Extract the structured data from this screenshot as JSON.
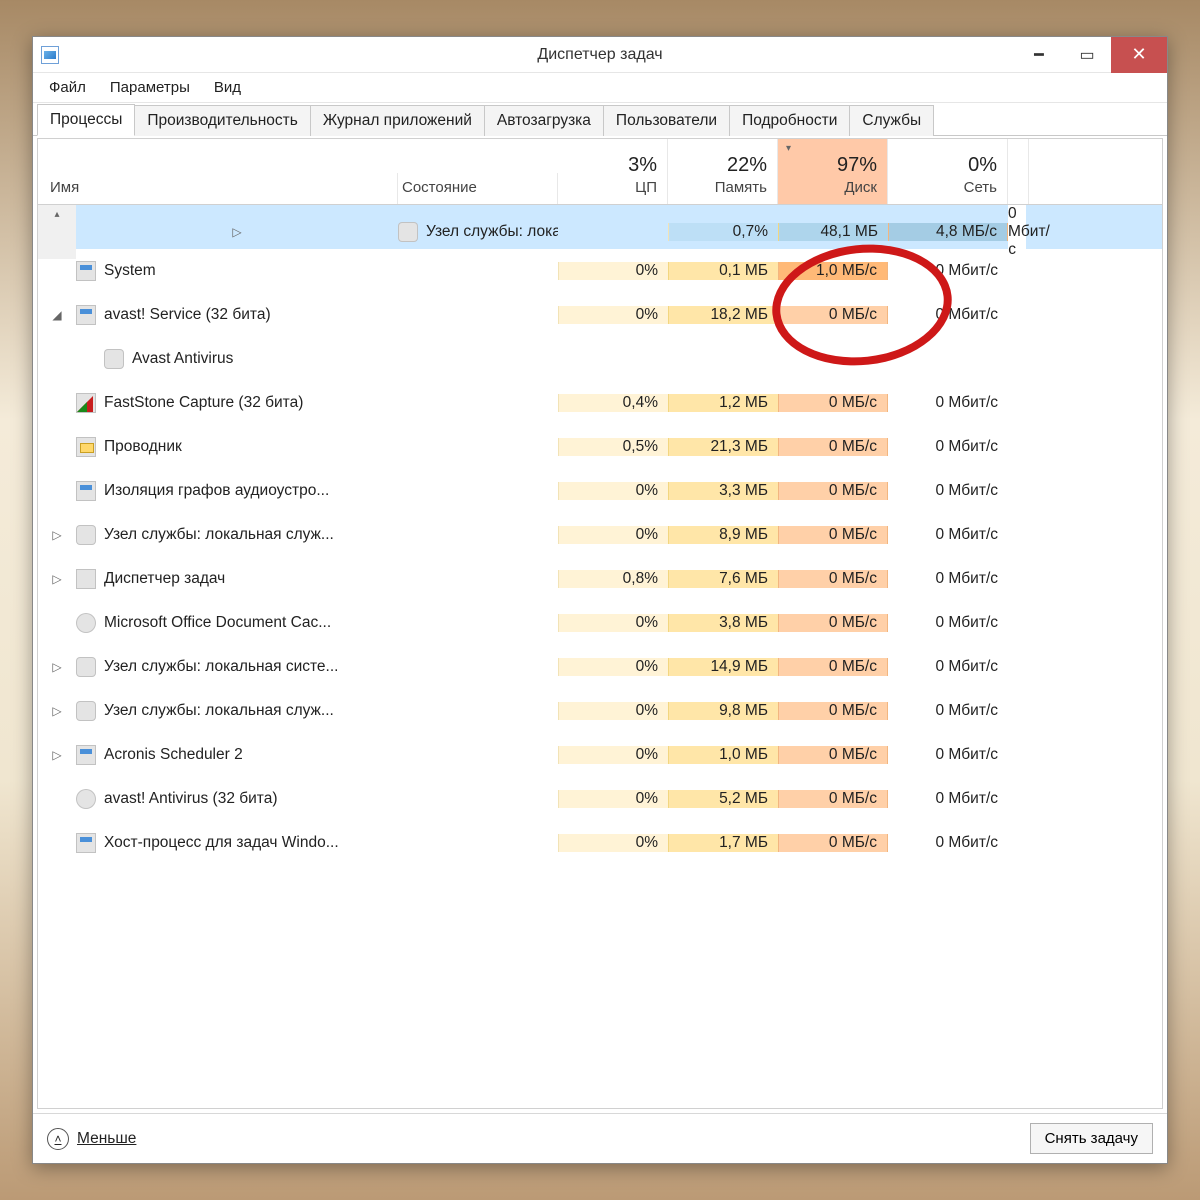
{
  "window": {
    "title": "Диспетчер задач"
  },
  "menu": {
    "file": "Файл",
    "options": "Параметры",
    "view": "Вид"
  },
  "tabs": {
    "processes": "Процессы",
    "performance": "Производительность",
    "app_history": "Журнал приложений",
    "startup": "Автозагрузка",
    "users": "Пользователи",
    "details": "Подробности",
    "services": "Службы"
  },
  "columns": {
    "name": "Имя",
    "status": "Состояние",
    "cpu_pct": "3%",
    "cpu_lbl": "ЦП",
    "mem_pct": "22%",
    "mem_lbl": "Память",
    "disk_pct": "97%",
    "disk_lbl": "Диск",
    "net_pct": "0%",
    "net_lbl": "Сеть"
  },
  "rows": [
    {
      "exp": "▷",
      "icon": "gear",
      "name": "Узел службы: локальная систе...",
      "cpu": "0,7%",
      "mem": "48,1 МБ",
      "disk": "4,8 МБ/с",
      "net": "0 Мбит/с",
      "selected": true
    },
    {
      "exp": "",
      "icon": "app",
      "name": "System",
      "cpu": "0%",
      "mem": "0,1 МБ",
      "disk": "1,0 МБ/с",
      "net": "0 Мбит/с",
      "diskhigh": true
    },
    {
      "exp": "◢",
      "icon": "app",
      "name": "avast! Service (32 бита)",
      "cpu": "0%",
      "mem": "18,2 МБ",
      "disk": "0 МБ/с",
      "net": "0 Мбит/с"
    },
    {
      "exp": "",
      "icon": "gear",
      "name": "Avast Antivirus",
      "child": true,
      "cpu": "",
      "mem": "",
      "disk": "",
      "net": ""
    },
    {
      "exp": "",
      "icon": "fs",
      "name": "FastStone Capture (32 бита)",
      "cpu": "0,4%",
      "mem": "1,2 МБ",
      "disk": "0 МБ/с",
      "net": "0 Мбит/с"
    },
    {
      "exp": "",
      "icon": "explorer",
      "name": "Проводник",
      "cpu": "0,5%",
      "mem": "21,3 МБ",
      "disk": "0 МБ/с",
      "net": "0 Мбит/с"
    },
    {
      "exp": "",
      "icon": "app",
      "name": "Изоляция графов аудиоустро...",
      "cpu": "0%",
      "mem": "3,3 МБ",
      "disk": "0 МБ/с",
      "net": "0 Мбит/с"
    },
    {
      "exp": "▷",
      "icon": "gear",
      "name": "Узел службы: локальная служ...",
      "cpu": "0%",
      "mem": "8,9 МБ",
      "disk": "0 МБ/с",
      "net": "0 Мбит/с"
    },
    {
      "exp": "▷",
      "icon": "tm",
      "name": "Диспетчер задач",
      "cpu": "0,8%",
      "mem": "7,6 МБ",
      "disk": "0 МБ/с",
      "net": "0 Мбит/с"
    },
    {
      "exp": "",
      "icon": "ms",
      "name": "Microsoft Office Document Cac...",
      "cpu": "0%",
      "mem": "3,8 МБ",
      "disk": "0 МБ/с",
      "net": "0 Мбит/с"
    },
    {
      "exp": "▷",
      "icon": "gear",
      "name": "Узел службы: локальная систе...",
      "cpu": "0%",
      "mem": "14,9 МБ",
      "disk": "0 МБ/с",
      "net": "0 Мбит/с"
    },
    {
      "exp": "▷",
      "icon": "gear",
      "name": "Узел службы: локальная служ...",
      "cpu": "0%",
      "mem": "9,8 МБ",
      "disk": "0 МБ/с",
      "net": "0 Мбит/с"
    },
    {
      "exp": "▷",
      "icon": "app",
      "name": "Acronis Scheduler 2",
      "cpu": "0%",
      "mem": "1,0 МБ",
      "disk": "0 МБ/с",
      "net": "0 Мбит/с"
    },
    {
      "exp": "",
      "icon": "avast",
      "name": "avast! Antivirus (32 бита)",
      "cpu": "0%",
      "mem": "5,2 МБ",
      "disk": "0 МБ/с",
      "net": "0 Мбит/с"
    },
    {
      "exp": "",
      "icon": "app",
      "name": "Хост-процесс для задач Windo...",
      "cpu": "0%",
      "mem": "1,7 МБ",
      "disk": "0 МБ/с",
      "net": "0 Мбит/с"
    }
  ],
  "footer": {
    "fewer": "Меньше",
    "end_task": "Снять задачу"
  }
}
